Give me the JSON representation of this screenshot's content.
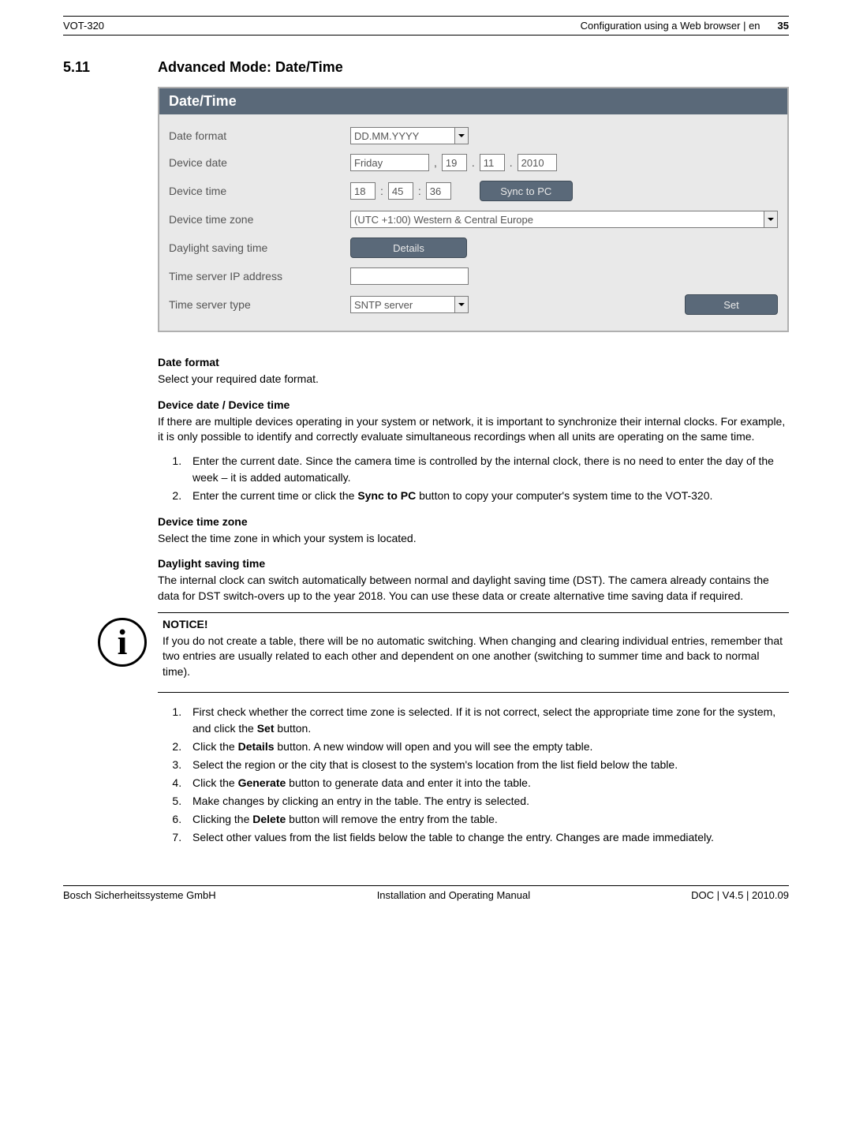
{
  "header": {
    "left": "VOT-320",
    "right_text": "Configuration using a Web browser | en",
    "page_num": "35"
  },
  "section": {
    "num": "5.11",
    "title": "Advanced Mode: Date/Time"
  },
  "panel": {
    "title": "Date/Time",
    "rows": {
      "date_format": {
        "label": "Date format",
        "value": "DD.MM.YYYY"
      },
      "device_date": {
        "label": "Device date",
        "weekday": "Friday",
        "d": "19",
        "m": "11",
        "y": "2010"
      },
      "device_time": {
        "label": "Device time",
        "h": "18",
        "mi": "45",
        "s": "36",
        "sync_btn": "Sync to PC"
      },
      "timezone": {
        "label": "Device time zone",
        "value": "(UTC +1:00) Western & Central Europe"
      },
      "dst": {
        "label": "Daylight saving time",
        "btn": "Details"
      },
      "ip": {
        "label": "Time server IP address",
        "value": ""
      },
      "type": {
        "label": "Time server type",
        "value": "SNTP server",
        "set_btn": "Set"
      }
    }
  },
  "body": {
    "h_date_format": "Date format",
    "p_date_format": "Select your required date format.",
    "h_device_date": "Device date / Device time",
    "p_device_date": "If there are multiple devices operating in your system or network, it is important to synchronize their internal clocks. For example, it is only possible to identify and correctly evaluate simultaneous recordings when all units are operating on the same time.",
    "ol1_1": "Enter the current date. Since the camera time is controlled by the internal clock, there is no need to enter the day of the week – it is added automatically.",
    "ol1_2a": "Enter the current time or click the ",
    "ol1_2b": "Sync to PC",
    "ol1_2c": " button to copy your computer's system time to the VOT-320.",
    "h_tz": "Device time zone",
    "p_tz": "Select the time zone in which your system is located.",
    "h_dst": "Daylight saving time",
    "p_dst": "The internal clock can switch automatically between normal and daylight saving time (DST). The camera already contains the data for DST switch-overs up to the year 2018. You can use these data or create alternative time saving data if required.",
    "notice_h": "NOTICE!",
    "notice_p": "If you do not create a table, there will be no automatic switching. When changing and clearing individual entries, remember that two entries are usually related to each other and dependent on one another (switching to summer time and back to normal time).",
    "ol2_1a": "First check whether the correct time zone is selected. If it is not correct, select the appropriate time zone for the system, and click the ",
    "ol2_1b": "Set",
    "ol2_1c": " button.",
    "ol2_2a": "Click the ",
    "ol2_2b": "Details",
    "ol2_2c": " button. A new window will open and you will see the empty table.",
    "ol2_3": "Select the region or the city that is closest to the system's location from the list field below the table.",
    "ol2_4a": "Click the ",
    "ol2_4b": "Generate",
    "ol2_4c": " button to generate data and enter it into the table.",
    "ol2_5": "Make changes by clicking an entry in the table. The entry is selected.",
    "ol2_6a": "Clicking the ",
    "ol2_6b": "Delete",
    "ol2_6c": " button will remove the entry from the table.",
    "ol2_7": "Select other values from the list fields below the table to change the entry. Changes are made immediately."
  },
  "footer": {
    "left": "Bosch Sicherheitssysteme GmbH",
    "center": "Installation and Operating Manual",
    "right": "DOC | V4.5 | 2010.09"
  }
}
